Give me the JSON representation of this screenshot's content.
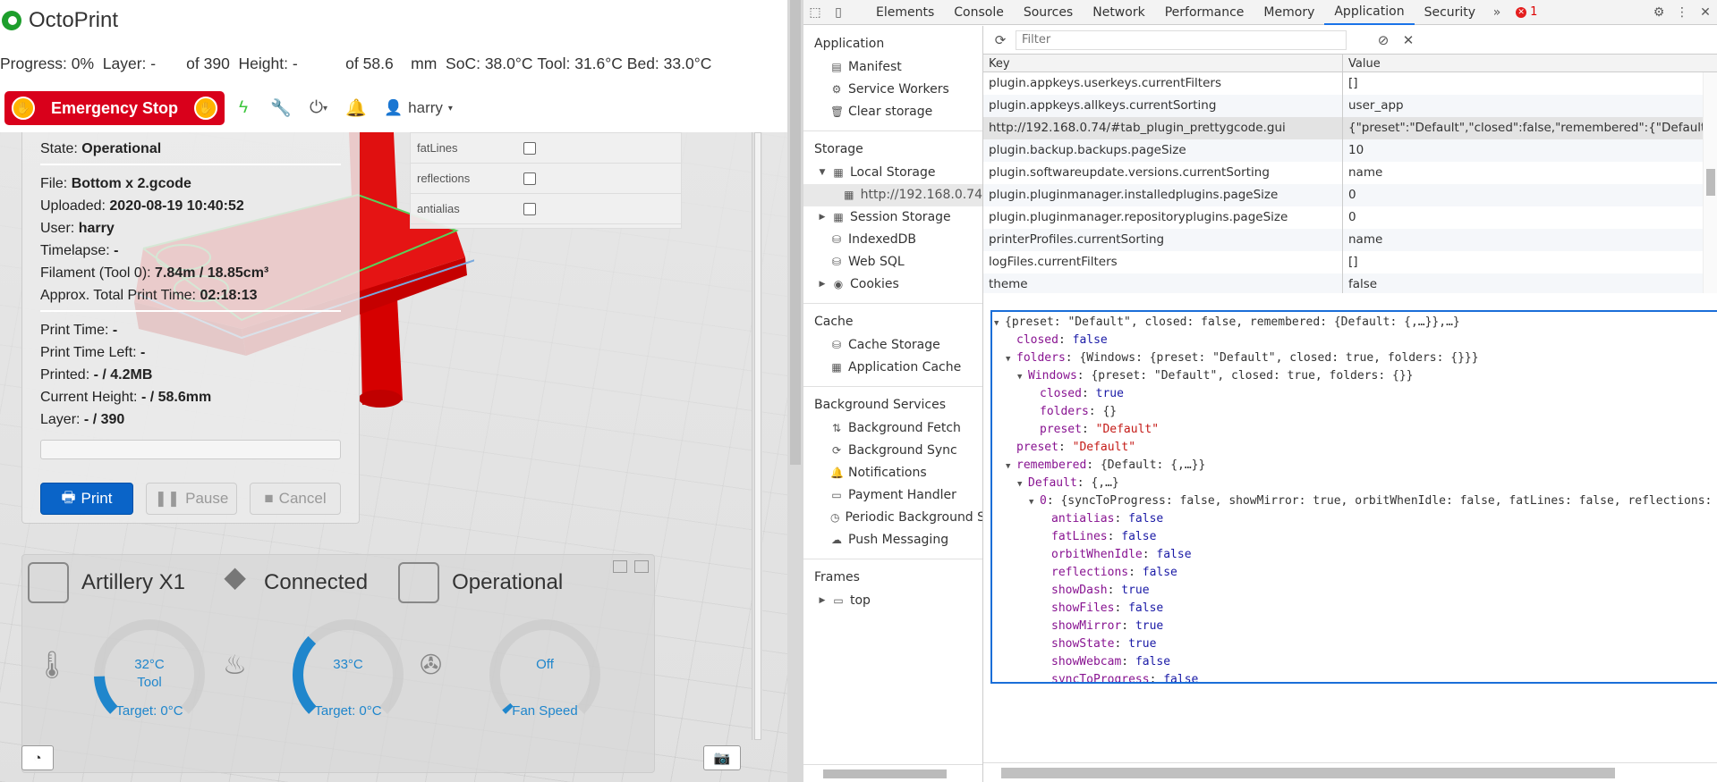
{
  "octoprint": {
    "brand": "OctoPrint",
    "status_bar": {
      "progress": "Progress: 0%",
      "layer": "Layer: -",
      "layer_of": "of 390",
      "height": "Height: -",
      "height_of": "of 58.6",
      "height_unit": "mm",
      "soc": "SoC: 38.0°C",
      "tool": "Tool: 31.6°C",
      "bed": "Bed: 33.0°C"
    },
    "nav": {
      "emergency_stop": "Emergency Stop",
      "user": "harry"
    },
    "gui_panel": {
      "rows": [
        {
          "label": "fatLines",
          "checked": false
        },
        {
          "label": "reflections",
          "checked": false
        },
        {
          "label": "antialias",
          "checked": false
        }
      ]
    },
    "state": {
      "state_label": "State:",
      "state_value": "Operational",
      "file_label": "File:",
      "file_value": "Bottom x 2.gcode",
      "uploaded_label": "Uploaded:",
      "uploaded_value": "2020-08-19 10:40:52",
      "user_label": "User:",
      "user_value": "harry",
      "timelapse_label": "Timelapse:",
      "timelapse_value": "-",
      "filament_label": "Filament (Tool 0):",
      "filament_value": "7.84m / 18.85cm³",
      "approx_label": "Approx. Total Print Time:",
      "approx_value": "02:18:13",
      "print_time_label": "Print Time:",
      "print_time_value": "-",
      "print_time_left_label": "Print Time Left:",
      "print_time_left_value": "-",
      "printed_label": "Printed:",
      "printed_value": "- / 4.2MB",
      "current_height_label": "Current Height:",
      "current_height_value": "- / 58.6mm",
      "layer_label": "Layer:",
      "layer_value": "- / 390",
      "progress_fraction": 0,
      "print_button": "Print",
      "pause_button": "Pause",
      "cancel_button": "Cancel"
    },
    "dashboard": {
      "printer_name": "Artillery X1",
      "connection": "Connected",
      "status": "Operational",
      "gauges": [
        {
          "value": "32°C",
          "sub": "Tool",
          "target": "Target: 0°C",
          "fill_fraction": 0.16,
          "color": "#1f86cc"
        },
        {
          "value": "33°C",
          "sub": "",
          "target": "Target: 0°C",
          "fill_fraction": 0.33,
          "color": "#1f86cc"
        },
        {
          "value": "Off",
          "sub": "",
          "target": "Fan Speed",
          "fill_fraction": 0.02,
          "color": "#1f86cc"
        }
      ]
    }
  },
  "devtools": {
    "tabs": [
      "Elements",
      "Console",
      "Sources",
      "Network",
      "Performance",
      "Memory",
      "Application",
      "Security"
    ],
    "active_tab": "Application",
    "more_tabs": "»",
    "error_count": "1",
    "sidebar": {
      "application_title": "Application",
      "application_items": [
        "Manifest",
        "Service Workers",
        "Clear storage"
      ],
      "storage_title": "Storage",
      "local_storage": "Local Storage",
      "local_storage_origin": "http://192.168.0.74",
      "storage_items": [
        "Session Storage",
        "IndexedDB",
        "Web SQL",
        "Cookies"
      ],
      "cache_title": "Cache",
      "cache_items": [
        "Cache Storage",
        "Application Cache"
      ],
      "background_title": "Background Services",
      "background_items": [
        "Background Fetch",
        "Background Sync",
        "Notifications",
        "Payment Handler",
        "Periodic Background Sync",
        "Push Messaging"
      ],
      "frames_title": "Frames",
      "frames_items": [
        "top"
      ]
    },
    "filter_placeholder": "Filter",
    "table": {
      "key_header": "Key",
      "value_header": "Value",
      "rows": [
        {
          "key": "plugin.appkeys.userkeys.currentFilters",
          "value": "[]"
        },
        {
          "key": "plugin.appkeys.allkeys.currentSorting",
          "value": "user_app"
        },
        {
          "key": "http://192.168.0.74/#tab_plugin_prettygcode.gui",
          "value": "{\"preset\":\"Default\",\"closed\":false,\"remembered\":{\"Default...",
          "selected": true
        },
        {
          "key": "plugin.backup.backups.pageSize",
          "value": "10"
        },
        {
          "key": "plugin.softwareupdate.versions.currentSorting",
          "value": "name"
        },
        {
          "key": "plugin.pluginmanager.installedplugins.pageSize",
          "value": "0"
        },
        {
          "key": "plugin.pluginmanager.repositoryplugins.pageSize",
          "value": "0"
        },
        {
          "key": "printerProfiles.currentSorting",
          "value": "name"
        },
        {
          "key": "logFiles.currentFilters",
          "value": "[]"
        },
        {
          "key": "theme",
          "value": "false"
        }
      ]
    },
    "preview_lines": [
      {
        "indent": 0,
        "arrow": "▼",
        "text": "{preset: \"Default\", closed: false, remembered: {Default: {,…}},…}",
        "kind": "plain"
      },
      {
        "indent": 1,
        "arrow": "",
        "key": "closed",
        "value": "false",
        "kind": "kw"
      },
      {
        "indent": 1,
        "arrow": "▼",
        "key": "folders",
        "value": "{Windows: {preset: \"Default\", closed: true, folders: {}}}",
        "kind": "plain"
      },
      {
        "indent": 2,
        "arrow": "▼",
        "key": "Windows",
        "value": "{preset: \"Default\", closed: true, folders: {}}",
        "kind": "plain"
      },
      {
        "indent": 3,
        "arrow": "",
        "key": "closed",
        "value": "true",
        "kind": "kw"
      },
      {
        "indent": 3,
        "arrow": "",
        "key": "folders",
        "value": "{}",
        "kind": "plain"
      },
      {
        "indent": 3,
        "arrow": "",
        "key": "preset",
        "value": "\"Default\"",
        "kind": "str"
      },
      {
        "indent": 1,
        "arrow": "",
        "key": "preset",
        "value": "\"Default\"",
        "kind": "str"
      },
      {
        "indent": 1,
        "arrow": "▼",
        "key": "remembered",
        "value": "{Default: {,…}}",
        "kind": "plain"
      },
      {
        "indent": 2,
        "arrow": "▼",
        "key": "Default",
        "value": "{,…}",
        "kind": "plain"
      },
      {
        "indent": 3,
        "arrow": "▼",
        "key": "0",
        "value": "{syncToProgress: false, showMirror: true, orbitWhenIdle: false, fatLines: false, reflections: false,…}",
        "kind": "plain"
      },
      {
        "indent": 4,
        "arrow": "",
        "key": "antialias",
        "value": "false",
        "kind": "kw"
      },
      {
        "indent": 4,
        "arrow": "",
        "key": "fatLines",
        "value": "false",
        "kind": "kw"
      },
      {
        "indent": 4,
        "arrow": "",
        "key": "orbitWhenIdle",
        "value": "false",
        "kind": "kw"
      },
      {
        "indent": 4,
        "arrow": "",
        "key": "reflections",
        "value": "false",
        "kind": "kw"
      },
      {
        "indent": 4,
        "arrow": "",
        "key": "showDash",
        "value": "true",
        "kind": "kw"
      },
      {
        "indent": 4,
        "arrow": "",
        "key": "showFiles",
        "value": "false",
        "kind": "kw"
      },
      {
        "indent": 4,
        "arrow": "",
        "key": "showMirror",
        "value": "true",
        "kind": "kw"
      },
      {
        "indent": 4,
        "arrow": "",
        "key": "showState",
        "value": "true",
        "kind": "kw"
      },
      {
        "indent": 4,
        "arrow": "",
        "key": "showWebcam",
        "value": "false",
        "kind": "kw"
      },
      {
        "indent": 4,
        "arrow": "",
        "key": "syncToProgress",
        "value": "false",
        "kind": "kw"
      }
    ]
  }
}
